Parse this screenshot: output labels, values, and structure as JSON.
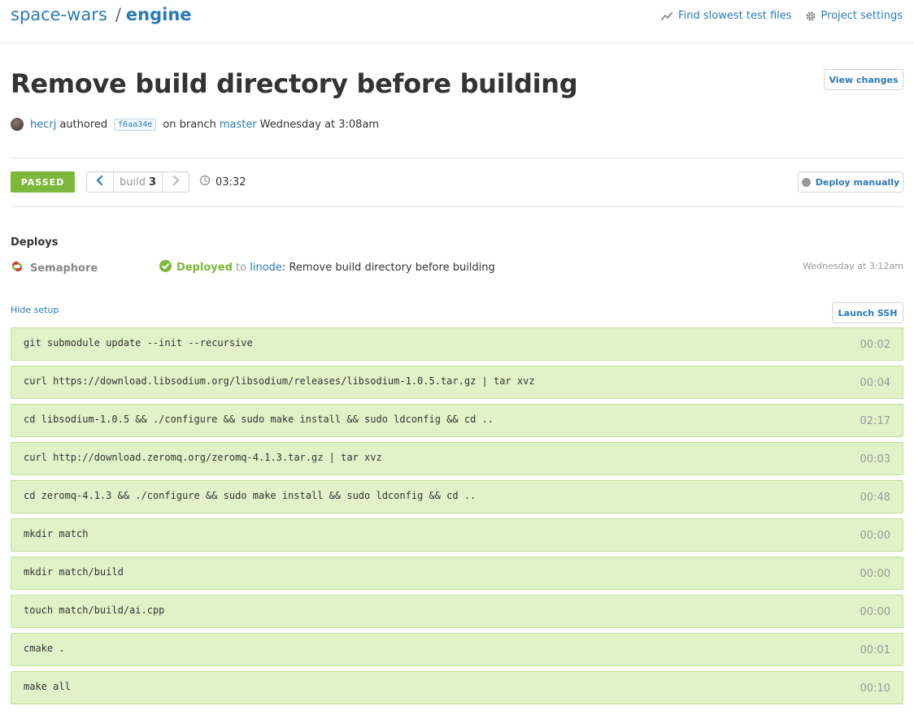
{
  "header": {
    "project": "space-wars",
    "separator": "/",
    "branch": "engine",
    "links": {
      "slowest_tests": "Find slowest test files",
      "project_settings": "Project settings"
    }
  },
  "commit": {
    "title": "Remove build directory before building",
    "author": "hecrj",
    "authored_text": "authored",
    "sha": "f6aa34e",
    "on_branch_text": "on branch",
    "branch": "master",
    "when": "Wednesday at 3:08am",
    "view_changes_label": "View changes"
  },
  "build": {
    "status": "PASSED",
    "status_color": "#7db83a",
    "build_label": "build",
    "build_number": "3",
    "duration": "03:32",
    "deploy_manually_label": "Deploy manually"
  },
  "deploys": {
    "heading": "Deploys",
    "items": [
      {
        "server": "Semaphore",
        "status": "Deployed",
        "to_text": "to",
        "target": "linode",
        "message": "Remove build directory before building",
        "time": "Wednesday at 3:12am"
      }
    ]
  },
  "setup": {
    "hide_label": "Hide setup",
    "launch_ssh_label": "Launch SSH",
    "commands": [
      {
        "cmd": "git submodule update --init --recursive",
        "time": "00:02"
      },
      {
        "cmd": "curl https://download.libsodium.org/libsodium/releases/libsodium-1.0.5.tar.gz | tar xvz",
        "time": "00:04"
      },
      {
        "cmd": "cd libsodium-1.0.5 && ./configure && sudo make install && sudo ldconfig && cd ..",
        "time": "02:17"
      },
      {
        "cmd": "curl http://download.zeromq.org/zeromq-4.1.3.tar.gz | tar xvz",
        "time": "00:03"
      },
      {
        "cmd": "cd zeromq-4.1.3 && ./configure && sudo make install && sudo ldconfig && cd ..",
        "time": "00:48"
      },
      {
        "cmd": "mkdir match",
        "time": "00:00"
      },
      {
        "cmd": "mkdir match/build",
        "time": "00:00"
      },
      {
        "cmd": "touch match/build/ai.cpp",
        "time": "00:00"
      },
      {
        "cmd": "cmake .",
        "time": "00:01"
      },
      {
        "cmd": "make all",
        "time": "00:10"
      }
    ]
  },
  "icons": {
    "slowest_tests": "trend-line-icon",
    "settings": "gear-icon",
    "prev": "chevron-left-icon",
    "next": "chevron-right-icon",
    "duration": "clock-icon",
    "deploy_dot": "status-dot-icon",
    "server": "semaphore-logo-icon",
    "deployed": "check-circle-icon"
  }
}
